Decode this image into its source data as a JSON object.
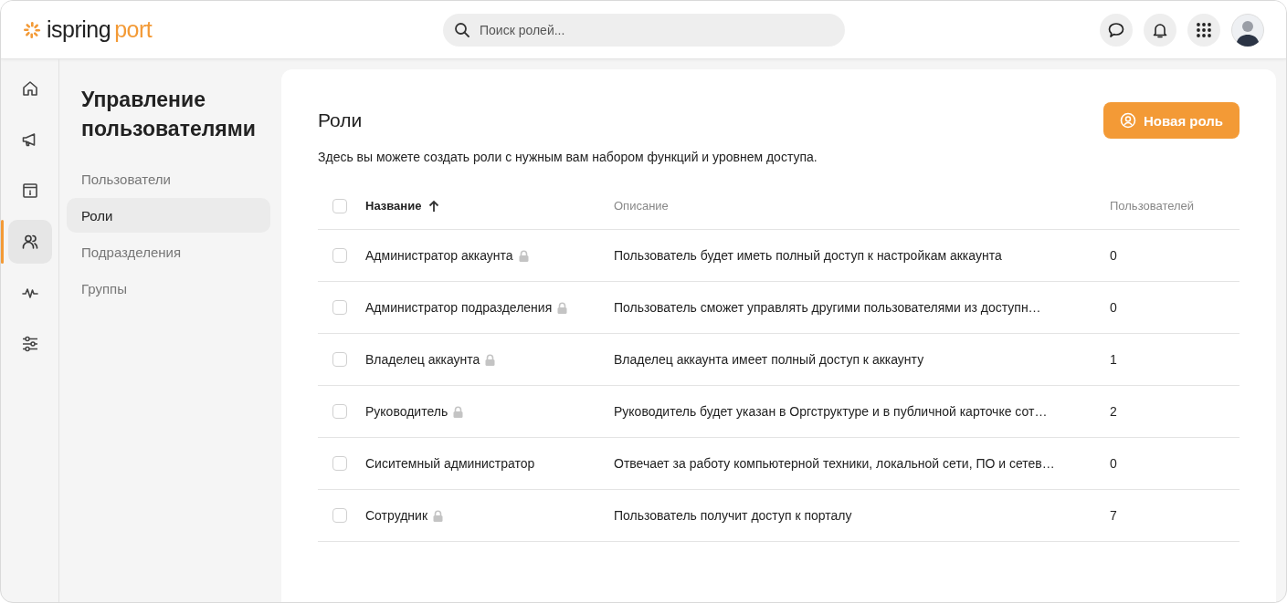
{
  "logo": {
    "brand": "ispring",
    "product": "port"
  },
  "search": {
    "placeholder": "Поиск ролей..."
  },
  "header_actions": [
    {
      "kind": "chat"
    },
    {
      "kind": "bell"
    },
    {
      "kind": "apps"
    }
  ],
  "rail": [
    {
      "kind": "home",
      "selected": false
    },
    {
      "kind": "megaphone",
      "selected": false
    },
    {
      "kind": "info",
      "selected": false
    },
    {
      "kind": "users",
      "selected": true
    },
    {
      "kind": "pulse",
      "selected": false
    },
    {
      "kind": "sliders",
      "selected": false
    }
  ],
  "sidebar": {
    "title": "Управление пользователями",
    "items": [
      {
        "label": "Пользователи",
        "selected": false
      },
      {
        "label": "Роли",
        "selected": true
      },
      {
        "label": "Подразделения",
        "selected": false
      },
      {
        "label": "Группы",
        "selected": false
      }
    ]
  },
  "page": {
    "title": "Роли",
    "subtitle": "Здесь вы можете создать роли с нужным вам набором функций и уровнем доступа.",
    "new_button": "Новая роль"
  },
  "table": {
    "select_all": false,
    "columns": [
      {
        "label": "Название",
        "sorted": true
      },
      {
        "label": "Описание",
        "sorted": false
      },
      {
        "label": "Пользователей",
        "sorted": false
      }
    ],
    "rows": [
      {
        "name": "Администратор аккаунта",
        "locked": true,
        "description": "Пользователь будет иметь полный доступ к настройкам аккаунта",
        "users": "0",
        "checked": false
      },
      {
        "name": "Администратор подразделения",
        "locked": true,
        "description": "Пользователь сможет управлять другими пользователями из доступн…",
        "users": "0",
        "checked": false
      },
      {
        "name": "Владелец аккаунта",
        "locked": true,
        "description": "Владелец аккаунта имеет полный доступ к аккаунту",
        "users": "1",
        "checked": false
      },
      {
        "name": "Руководитель",
        "locked": true,
        "description": "Руководитель будет указан в Оргструктуре и в публичной карточке сот…",
        "users": "2",
        "checked": false
      },
      {
        "name": "Сиситемный администратор",
        "locked": false,
        "description": "Отвечает за работу компьютерной техники, локальной сети, ПО и сетев…",
        "users": "0",
        "checked": false
      },
      {
        "name": "Сотрудник",
        "locked": true,
        "description": "Пользователь получит доступ к порталу",
        "users": "7",
        "checked": false
      }
    ]
  }
}
